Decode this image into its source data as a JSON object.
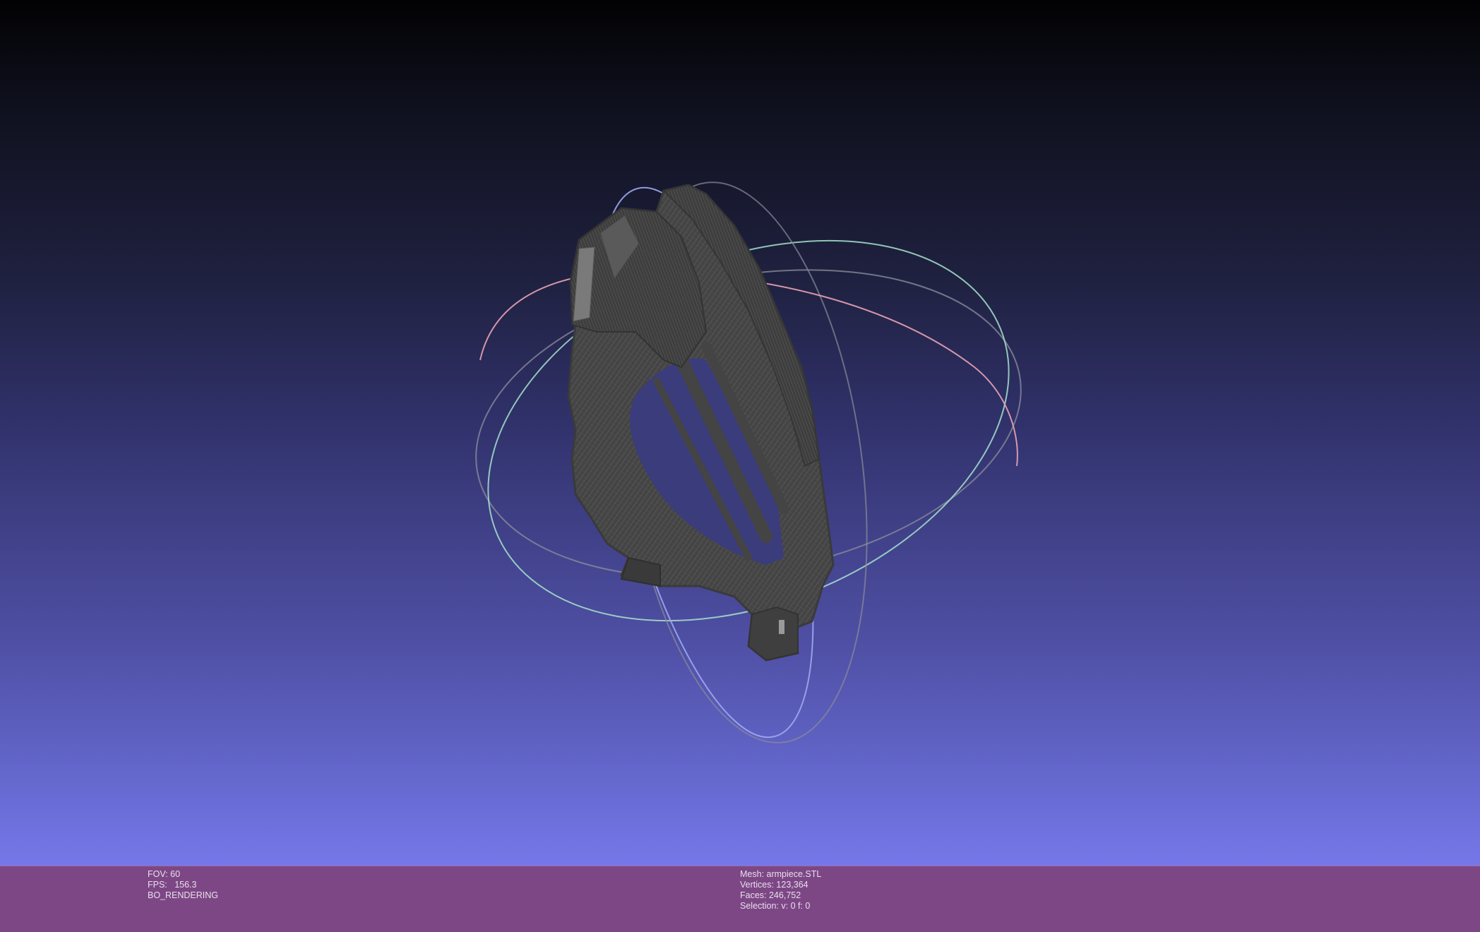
{
  "viewer": {
    "background_top": "#020204",
    "background_bottom": "#7678ea",
    "mesh_color": "#4a4a4a",
    "trackball_colors": {
      "x_ring": "#e9a3b5",
      "y_ring": "#9fa8ee",
      "z_ring": "#a6e3cb",
      "guide": "#8a8a9a"
    }
  },
  "info_bar": {
    "background": "#7d4786",
    "left": {
      "fov": "FOV: 60",
      "fps": "FPS:   156.3",
      "mode": "BO_RENDERING"
    },
    "right": {
      "mesh": "Mesh: armpiece.STL",
      "vertices": "Vertices: 123,364",
      "faces": "Faces: 246,752",
      "selection": "Selection: v: 0 f: 0"
    }
  }
}
